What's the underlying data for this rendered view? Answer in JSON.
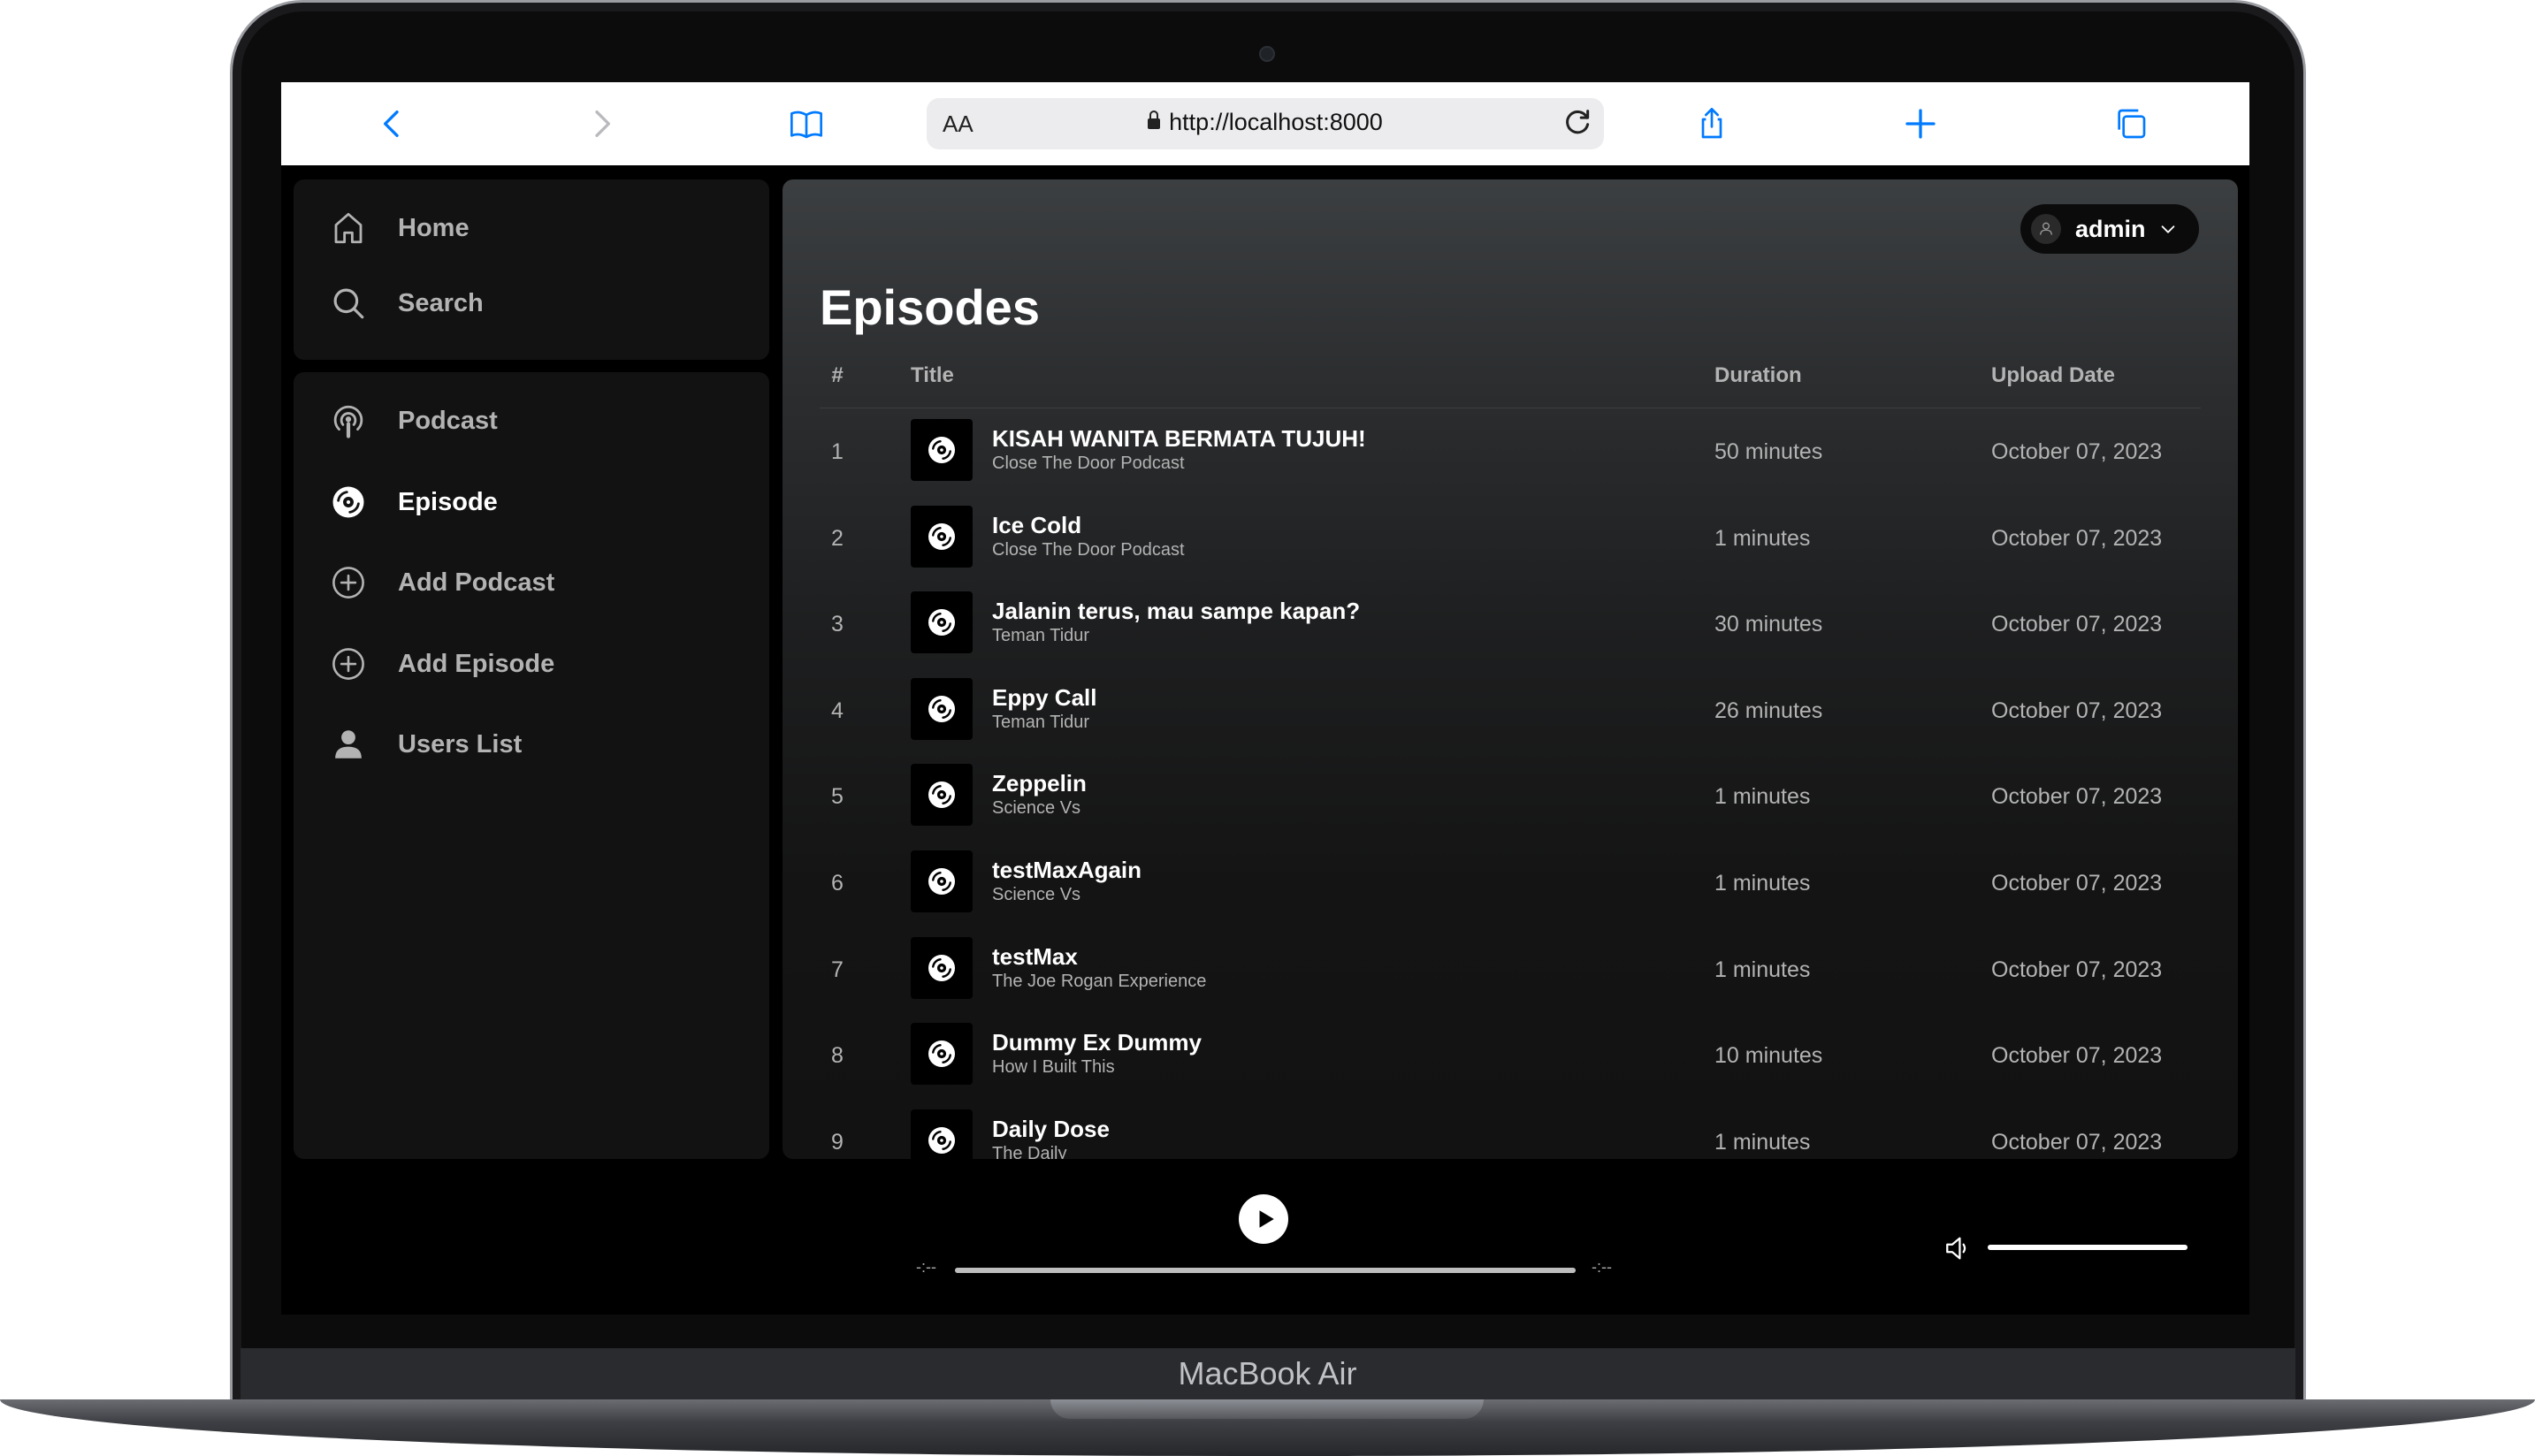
{
  "device": {
    "label": "MacBook Air"
  },
  "browser": {
    "text_size_label": "AA",
    "url": "http://localhost:8000"
  },
  "sidebar": {
    "top_items": [
      {
        "label": "Home",
        "icon": "home-icon"
      },
      {
        "label": "Search",
        "icon": "search-icon"
      }
    ],
    "library_items": [
      {
        "label": "Podcast",
        "icon": "podcast-icon",
        "active": false
      },
      {
        "label": "Episode",
        "icon": "disc-icon",
        "active": true
      },
      {
        "label": "Add Podcast",
        "icon": "plus-circle-icon",
        "active": false
      },
      {
        "label": "Add Episode",
        "icon": "plus-circle-icon",
        "active": false
      },
      {
        "label": "Users List",
        "icon": "user-icon",
        "active": false
      }
    ]
  },
  "header": {
    "username": "admin"
  },
  "main": {
    "title": "Episodes",
    "columns": {
      "number": "#",
      "title": "Title",
      "duration": "Duration",
      "upload_date": "Upload Date"
    },
    "episodes": [
      {
        "number": "1",
        "title": "KISAH WANITA BERMATA TUJUH!",
        "podcast": "Close The Door Podcast",
        "duration": "50 minutes",
        "date": "October 07, 2023"
      },
      {
        "number": "2",
        "title": "Ice Cold",
        "podcast": "Close The Door Podcast",
        "duration": "1 minutes",
        "date": "October 07, 2023"
      },
      {
        "number": "3",
        "title": "Jalanin terus, mau sampe kapan?",
        "podcast": "Teman Tidur",
        "duration": "30 minutes",
        "date": "October 07, 2023"
      },
      {
        "number": "4",
        "title": "Eppy Call",
        "podcast": "Teman Tidur",
        "duration": "26 minutes",
        "date": "October 07, 2023"
      },
      {
        "number": "5",
        "title": "Zeppelin",
        "podcast": "Science Vs",
        "duration": "1 minutes",
        "date": "October 07, 2023"
      },
      {
        "number": "6",
        "title": "testMaxAgain",
        "podcast": "Science Vs",
        "duration": "1 minutes",
        "date": "October 07, 2023"
      },
      {
        "number": "7",
        "title": "testMax",
        "podcast": "The Joe Rogan Experience",
        "duration": "1 minutes",
        "date": "October 07, 2023"
      },
      {
        "number": "8",
        "title": "Dummy Ex Dummy",
        "podcast": "How I Built This",
        "duration": "10 minutes",
        "date": "October 07, 2023"
      },
      {
        "number": "9",
        "title": "Daily Dose",
        "podcast": "The Daily",
        "duration": "1 minutes",
        "date": "October 07, 2023"
      }
    ]
  },
  "player": {
    "elapsed": "-:--",
    "remaining": "-:--",
    "progress_fraction": 1.0,
    "volume_fraction": 1.0
  },
  "colors": {
    "accent": "#007aff",
    "sidebar_bg": "#121212",
    "text_primary": "#ffffff",
    "text_secondary": "#b3b3b3"
  }
}
